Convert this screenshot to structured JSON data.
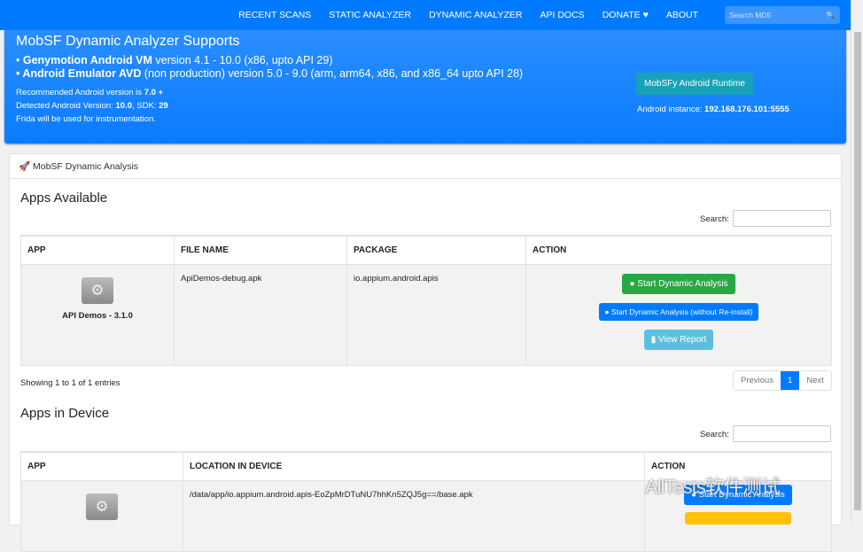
{
  "nav": {
    "items": [
      "RECENT SCANS",
      "STATIC ANALYZER",
      "DYNAMIC ANALYZER",
      "API DOCS",
      "DONATE ♥",
      "ABOUT"
    ],
    "search_placeholder": "Search MD5"
  },
  "banner": {
    "title": "MobSF Dynamic Analyzer Supports",
    "line1_bold": "• Genymotion Android VM",
    "line1_rest": " version 4.1 - 10.0 (x86, upto API 29)",
    "line2_bold": "• Android Emulator AVD",
    "line2_rest": " (non production) version 5.0 - 9.0 (arm, arm64, x86, and x86_64 upto API 28)",
    "rec_label": "Recommended Android version is ",
    "rec_value": "7.0 +",
    "det_label": "Detected Android Version: ",
    "det_version": "10.0",
    "det_sdk_label": ", SDK: ",
    "det_sdk": "29",
    "frida": "Frida will be used for instrumentation.",
    "runtime_button": "MobSFy Android Runtime",
    "instance_label": "Android instance: ",
    "instance_value": "192.168.176.101:5555"
  },
  "card": {
    "title": "MobSF Dynamic Analysis"
  },
  "available": {
    "heading": "Apps Available",
    "search_label": "Search:",
    "headers": [
      "APP",
      "FILE NAME",
      "PACKAGE",
      "ACTION"
    ],
    "row": {
      "app": "API Demos - 3.1.0",
      "file": "ApiDemos-debug.apk",
      "package": "io.appium.android.apis",
      "btn_start": "Start Dynamic Analysis",
      "btn_noreinstall": "Start Dynamic Analysis (without Re-install)",
      "btn_report": "View Report"
    },
    "showing": "Showing 1 to 1 of 1 entries",
    "pagination": {
      "prev": "Previous",
      "page": "1",
      "next": "Next"
    }
  },
  "device": {
    "heading": "Apps in Device",
    "search_label": "Search:",
    "headers": [
      "APP",
      "LOCATION IN DEVICE",
      "ACTION"
    ],
    "row": {
      "location": "/data/app/io.appium.android.apis-EoZpMrDTuNU7hhKn5ZQJ5g==/base.apk",
      "btn_start": "Start Dynamic Analysis"
    }
  },
  "watermark": "AllTests软件测试"
}
